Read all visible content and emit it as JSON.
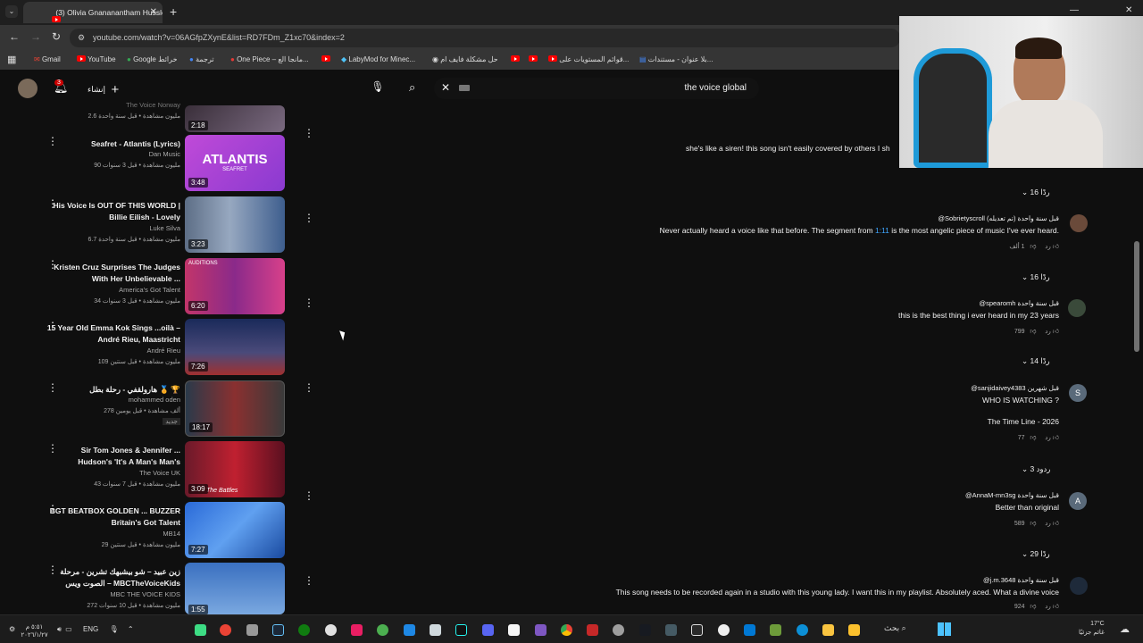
{
  "browser": {
    "tab_title": "(3) Olivia Gnananantham Hussle",
    "url": "youtube.com/watch?v=06AGfpZXynE&list=RD7FDm_Z1xc70&index=2",
    "bookmarks": [
      "Gmail",
      "YouTube",
      "Google خرائط",
      "ترجمة",
      "One Piece – مانجا الع...",
      "LabyMod for Minec...",
      "حل مشكلة فايف ام",
      "قوائم المستويات على...",
      "بلا عنوان - مستندات..."
    ]
  },
  "yt": {
    "create_label": "إنشاء",
    "notif_count": "3",
    "search_query": "the voice global"
  },
  "playlist": [
    {
      "title": "",
      "channel": "The Voice Norway",
      "meta": "2.6 مليون مشاهدة • قبل سنة واحدة",
      "duration": "2:18"
    },
    {
      "title": "Seafret - Atlantis (Lyrics)",
      "channel": "Dan Music",
      "meta": "90 مليون مشاهدة • قبل 3 سنوات",
      "duration": "3:48",
      "thumb_text": "ATLANTIS",
      "thumb_sub": "SEAFRET"
    },
    {
      "title": "His Voice Is OUT OF THIS WORLD | Billie Eilish - Lovely",
      "channel": "Luke Silva",
      "meta": "6.7 مليون مشاهدة • قبل سنة واحدة",
      "duration": "3:23"
    },
    {
      "title": "Kristen Cruz Surprises The Judges With Her Unbelievable ...",
      "channel": "America's Got Talent",
      "meta": "34 مليون مشاهدة • قبل 3 سنوات",
      "duration": "6:20",
      "thumb_text": "AUDITIONS"
    },
    {
      "title": "15 Year Old Emma Kok Sings ...oilà – André Rieu, Maastricht",
      "channel": "André Rieu",
      "meta": "109 مليون مشاهدة • قبل سنتين",
      "duration": "7:26"
    },
    {
      "title": "هارولقفي - رحلة بطل 🏅 🏆",
      "channel": "mohammed oden",
      "meta": "278 ألف مشاهدة • قبل يومين",
      "badge": "جديد",
      "duration": "18:17"
    },
    {
      "title": "Sir Tom Jones & Jennifer ... Hudson's 'It's A Man's Man's",
      "channel": "The Voice UK",
      "meta": "43 مليون مشاهدة • قبل 7 سنوات",
      "duration": "3:09",
      "thumb_text": "The Battles"
    },
    {
      "title": "BGT BEATBOX GOLDEN ... BUZZER Britain's Got Talent",
      "channel": "MB14",
      "meta": "29 مليون مشاهدة • قبل سنتين",
      "duration": "7:27"
    },
    {
      "title": "زين عبيد – شو بيشبهك تشرين - مرحلة الصوت ويس – MBCTheVoiceKids",
      "channel": "MBC THE VOICE KIDS",
      "meta": "272 مليون مشاهدة • قبل 10 سنوات",
      "duration": "1:55"
    }
  ],
  "comments": [
    {
      "user": "",
      "text": "she's like a siren! this song isn't easily covered by others I sh",
      "likes": "",
      "replies": "16 ردًا"
    },
    {
      "user": "@Sobrietyscroll قبل سنة واحدة (تم تعديله)",
      "text_a": "Never actually heard a voice like that before. The segment from ",
      "link": "1:11",
      "text_b": " is the most angelic piece of music I've ever heard.",
      "likes": "1 ألف",
      "reply": "رد",
      "replies": "16 ردًا"
    },
    {
      "user": "@spearomh قبل سنة واحدة",
      "text": "this is the best thing i ever heard in my 23 years",
      "likes": "799",
      "reply": "رد",
      "replies": "14 ردًا"
    },
    {
      "user": "@sanjidaivey4383 قبل شهرين",
      "text": "WHO IS WATCHING ?",
      "text2": "The Time Line - 2026",
      "likes": "77",
      "reply": "رد",
      "replies": "3 ردود",
      "avatar": "S"
    },
    {
      "user": "@AnnaM-mn3sg قبل سنة واحدة",
      "text": "Better than original",
      "likes": "589",
      "reply": "رد",
      "replies": "29 ردًا",
      "avatar": "A"
    },
    {
      "user": "@j.m.3648 قبل سنة واحدة",
      "text": "This song needs to be recorded again in a studio with this young lady. I want this in my playlist. Absolutely aced. What a divine voice",
      "likes": "924",
      "reply": "رد"
    }
  ],
  "taskbar": {
    "time": "٥:٥١ م",
    "date": "٢٠٢٦/١/٢٧",
    "lang": "ENG",
    "search": "بحث",
    "weather_temp": "17°C",
    "weather_desc": "غائم جزئيًا"
  },
  "colors": {
    "accent": "#ff0000",
    "link": "#3ea6ff",
    "bg": "#0f0f0f"
  }
}
